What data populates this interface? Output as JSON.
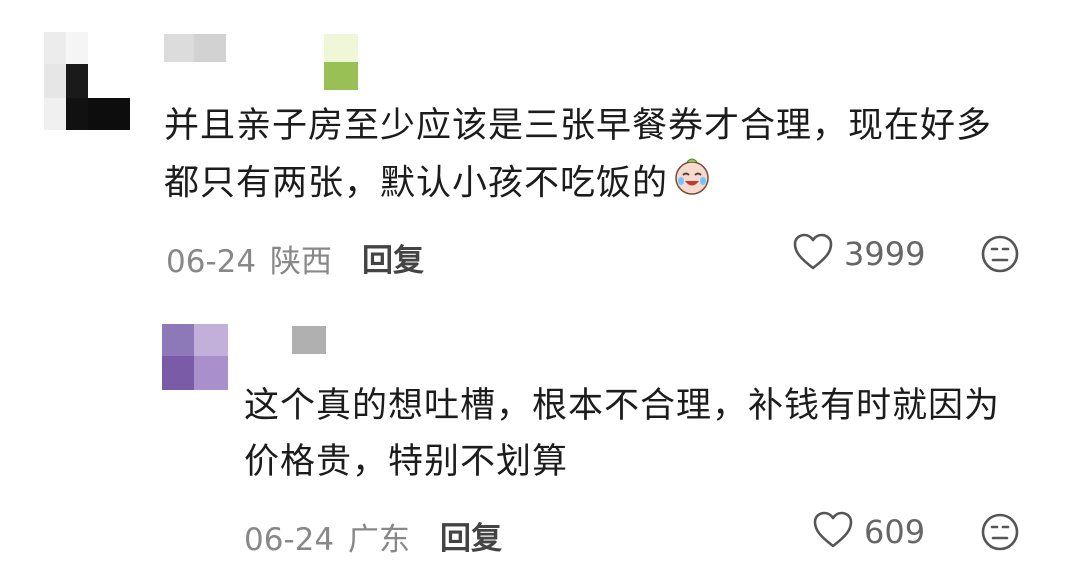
{
  "comments": [
    {
      "text": "并且亲子房至少应该是三张早餐券才合理，现在好多都只有两张，默认小孩不吃饭的",
      "line1": "并且亲子房至少应该是三张早餐券才合理，现在好多",
      "line2": "都只有两张，默认小孩不吃饭的",
      "emoji": "crying-laughing-emoji",
      "date": "06-24",
      "location": "陕西",
      "reply_label": "回复",
      "likes": "3999"
    },
    {
      "text": "这个真的想吐槽，根本不合理，补钱有时就因为价格贵，特别不划算",
      "line1": "这个真的想吐槽，根本不合理，补钱有时就因为",
      "line2": "价格贵，特别不划算",
      "date": "06-24",
      "location": "广东",
      "reply_label": "回复",
      "likes": "609"
    }
  ],
  "icons": {
    "like": "heart-outline-icon",
    "dislike": "neutral-face-icon"
  },
  "colors": {
    "text": "#1c1c1c",
    "meta": "#888888",
    "icon": "#555555"
  }
}
